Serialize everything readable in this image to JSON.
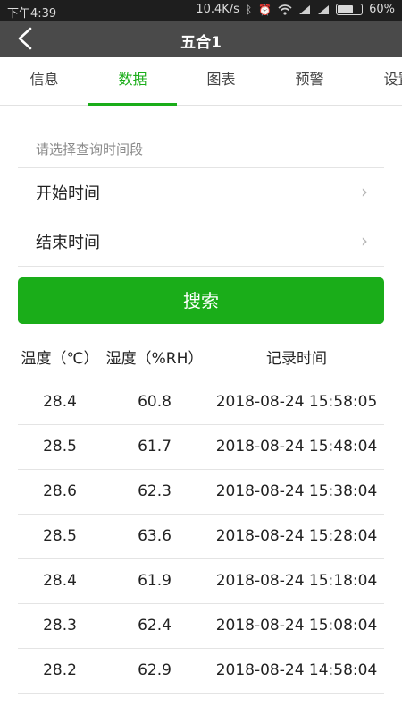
{
  "status_bar": {
    "time": "下午4:39",
    "speed": "10.4K/s",
    "battery": "60%",
    "battery_level": 0.6
  },
  "title": "五合1",
  "tabs": [
    "信息",
    "数据",
    "图表",
    "预警",
    "设置"
  ],
  "active_tab": 1,
  "query": {
    "hint": "请选择查询时间段",
    "start_label": "开始时间",
    "end_label": "结束时间",
    "search_label": "搜索"
  },
  "table": {
    "headers": [
      "温度（℃）",
      "湿度（%RH）",
      "记录时间"
    ],
    "rows": [
      [
        "28.4",
        "60.8",
        "2018-08-24 15:58:05"
      ],
      [
        "28.5",
        "61.7",
        "2018-08-24 15:48:04"
      ],
      [
        "28.6",
        "62.3",
        "2018-08-24 15:38:04"
      ],
      [
        "28.5",
        "63.6",
        "2018-08-24 15:28:04"
      ],
      [
        "28.4",
        "61.9",
        "2018-08-24 15:18:04"
      ],
      [
        "28.3",
        "62.4",
        "2018-08-24 15:08:04"
      ],
      [
        "28.2",
        "62.9",
        "2018-08-24 14:58:04"
      ]
    ]
  }
}
